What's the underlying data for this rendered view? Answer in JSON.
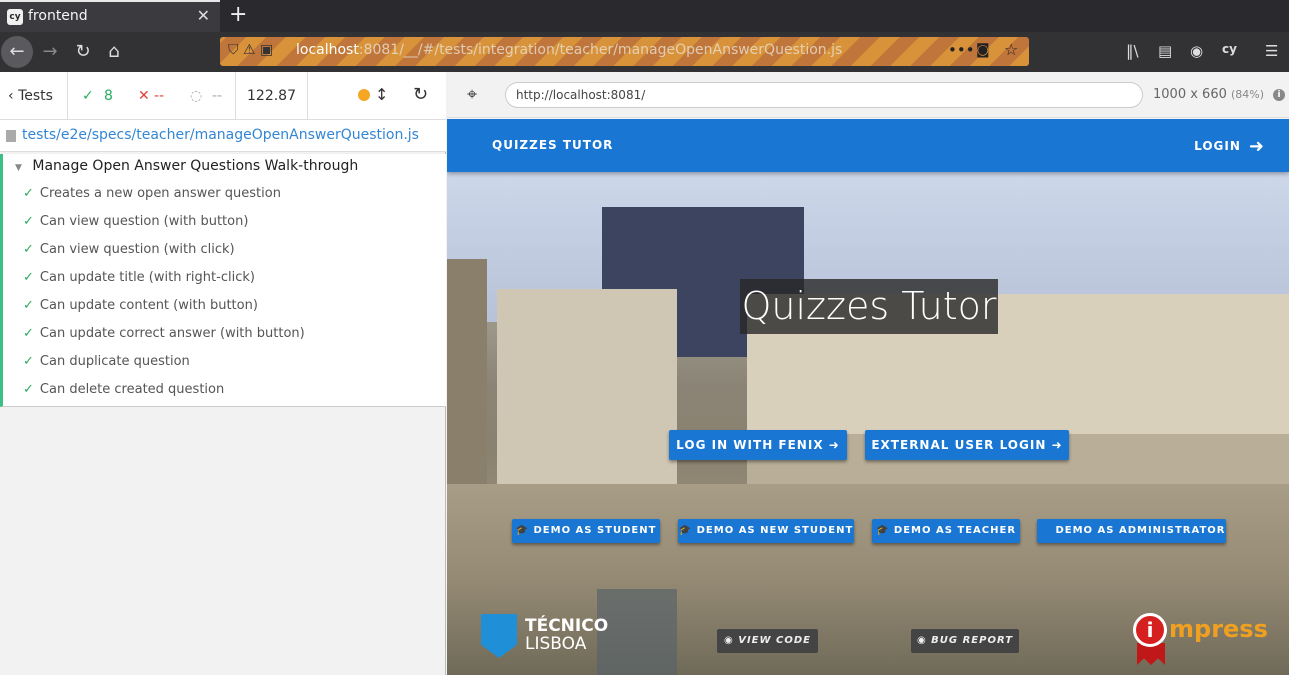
{
  "browser": {
    "tab_title": "frontend",
    "tab_favicon": "cy",
    "new_tab_label": "+",
    "url_host": "localhost",
    "url_path": ":8081/__/#/tests/integration/teacher/manageOpenAnswerQuestion.js",
    "toolbar_icons": [
      "back-icon",
      "forward-icon",
      "reload-icon",
      "home-icon",
      "library-icon",
      "sidebar-icon",
      "account-icon",
      "cypress-extension-icon",
      "menu-icon"
    ]
  },
  "reporter": {
    "tests_label": "Tests",
    "passed": "8",
    "failed": "--",
    "pending": "--",
    "duration": "122.87",
    "spec_path": "tests/e2e/specs/teacher/manageOpenAnswerQuestion.js",
    "suite_title": "Manage Open Answer Questions Walk-through",
    "tests": [
      "Creates a new open answer question",
      "Can view question (with button)",
      "Can view question (with click)",
      "Can update title (with right-click)",
      "Can update content (with button)",
      "Can update correct answer (with button)",
      "Can duplicate question",
      "Can delete created question"
    ]
  },
  "aut": {
    "url": "http://localhost:8081/",
    "viewport": "1000 x 660",
    "scale": "(84%)"
  },
  "app": {
    "brand": "QUIZZES TUTOR",
    "login": "LOGIN",
    "hero_title": "Quizzes Tutor",
    "login_fenix": "LOG IN WITH FENIX",
    "external_login": "EXTERNAL USER LOGIN",
    "demo_student": "DEMO AS STUDENT",
    "demo_new_student": "DEMO AS NEW STUDENT",
    "demo_teacher": "DEMO AS TEACHER",
    "demo_admin": "DEMO AS ADMINISTRATOR",
    "view_code": "VIEW CODE",
    "bug_report": "BUG REPORT",
    "tecnico_line1": "TÉCNICO",
    "tecnico_line2": "LISBOA",
    "impress_badge": "i",
    "impress_word": "mpress",
    "primary_color": "#1976d2"
  }
}
